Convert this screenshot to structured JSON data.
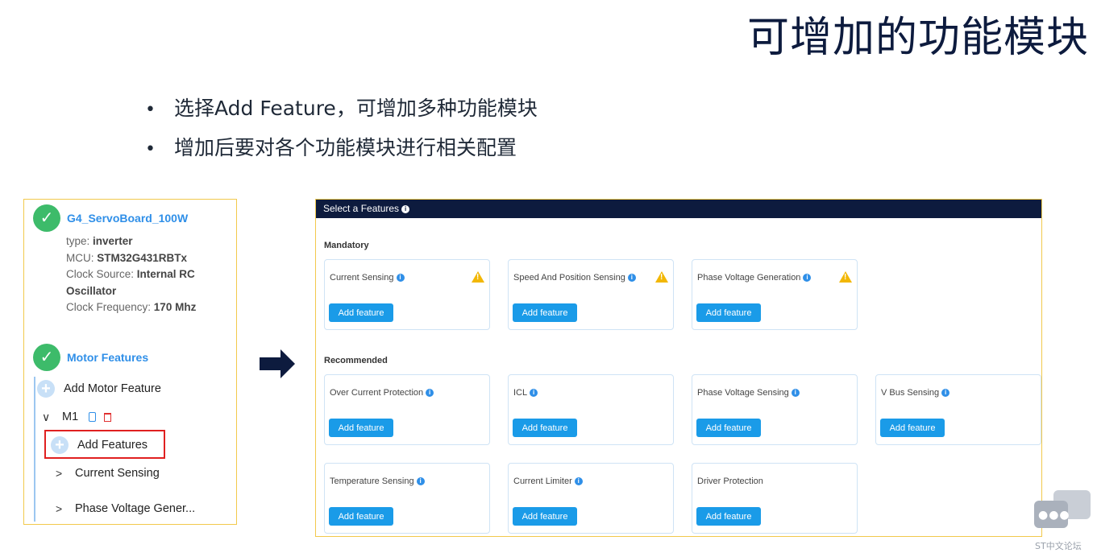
{
  "slide": {
    "title": "可增加的功能模块",
    "bullets": [
      "选择Add Feature，可增加多种功能模块",
      "增加后要对各个功能模块进行相关配置"
    ]
  },
  "left_panel": {
    "board_name": "G4_ServoBoard_100W",
    "type_label": "type: ",
    "type_value": "inverter",
    "mcu_label": "MCU: ",
    "mcu_value": "STM32G431RBTx",
    "clock_source_label": "Clock Source: ",
    "clock_source_value": "Internal RC Oscillator",
    "clock_freq_label": "Clock Frequency: ",
    "clock_freq_value": "170 Mhz",
    "motor_features_title": "Motor Features",
    "add_motor_feature": "Add Motor Feature",
    "motor_name": "M1",
    "add_features": "Add Features",
    "tree_items": [
      "Current Sensing",
      "Phase Voltage Gener..."
    ]
  },
  "right_panel": {
    "header": "Select a Features",
    "mandatory_label": "Mandatory",
    "recommended_label": "Recommended",
    "add_button_label": "Add feature",
    "mandatory": [
      "Current Sensing",
      "Speed And Position Sensing",
      "Phase Voltage Generation"
    ],
    "recommended_row1": [
      "Over Current Protection",
      "ICL",
      "Phase Voltage Sensing",
      "V Bus Sensing"
    ],
    "recommended_row2": [
      "Temperature Sensing",
      "Current Limiter",
      "Driver Protection"
    ]
  },
  "watermark": {
    "text": "ST中文论坛"
  },
  "colors": {
    "navy": "#0d1b3e",
    "accent_blue": "#1a9be8",
    "check_green": "#3dbb6a",
    "highlight_red": "#e02020",
    "panel_border": "#f2c94c"
  }
}
